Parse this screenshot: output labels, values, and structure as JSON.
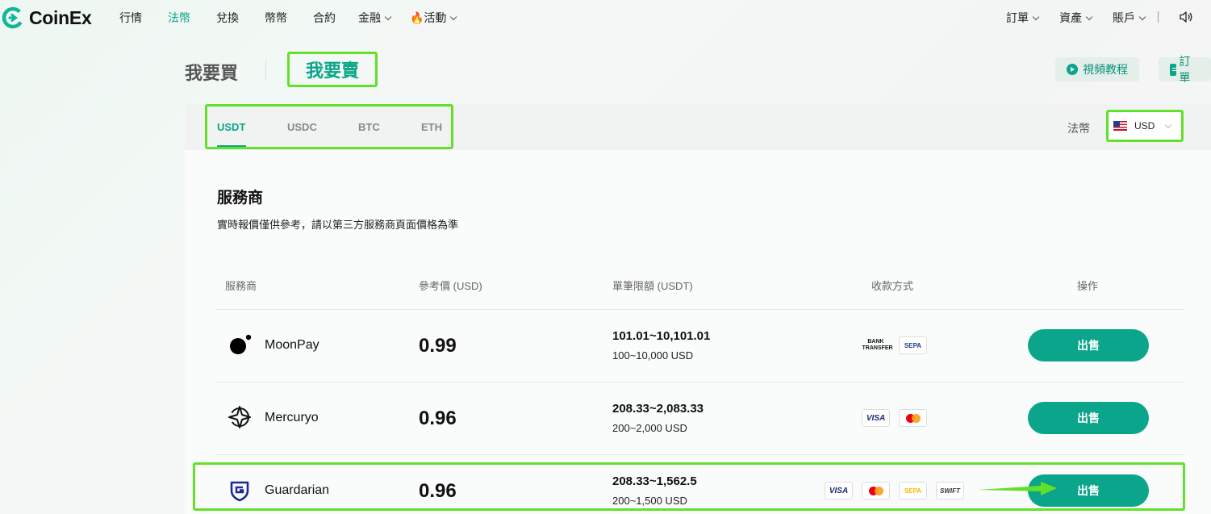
{
  "brand": {
    "name": "CoinEx"
  },
  "nav": {
    "items": [
      {
        "label": "行情"
      },
      {
        "label": "法幣"
      },
      {
        "label": "兌換"
      },
      {
        "label": "幣幣"
      },
      {
        "label": "合約"
      },
      {
        "label": "金融"
      },
      {
        "label": "🔥活動"
      }
    ],
    "right": [
      {
        "label": "訂單"
      },
      {
        "label": "資產"
      },
      {
        "label": "賬戶"
      }
    ]
  },
  "trade_tabs": {
    "buy": "我要買",
    "sell": "我要賣"
  },
  "actions": {
    "video": "視頻教程",
    "orders": "訂單"
  },
  "coins": [
    "USDT",
    "USDC",
    "BTC",
    "ETH"
  ],
  "fiat": {
    "label": "法幣",
    "value": "USD"
  },
  "section": {
    "title": "服務商",
    "subtitle": "實時報價僅供參考，請以第三方服務商頁面價格為準"
  },
  "table": {
    "headers": [
      "服務商",
      "參考價 (USD)",
      "單筆限額 (USDT)",
      "收款方式",
      "操作"
    ],
    "rows": [
      {
        "name": "MoonPay",
        "price": "0.99",
        "limit_usdt": "101.01~10,101.01",
        "limit_usd": "100~10,000 USD",
        "payments": [
          "BANK TRANSFER",
          "SEPA"
        ],
        "action": "出售"
      },
      {
        "name": "Mercuryo",
        "price": "0.96",
        "limit_usdt": "208.33~2,083.33",
        "limit_usd": "200~2,000 USD",
        "payments": [
          "VISA",
          "Mastercard"
        ],
        "action": "出售"
      },
      {
        "name": "Guardarian",
        "price": "0.96",
        "limit_usdt": "208.33~1,562.5",
        "limit_usd": "200~1,500 USD",
        "payments": [
          "VISA",
          "Mastercard",
          "SEPA",
          "SWIFT"
        ],
        "action": "出售"
      }
    ]
  },
  "colors": {
    "accent": "#0aa58a",
    "highlight": "#64e02a"
  }
}
